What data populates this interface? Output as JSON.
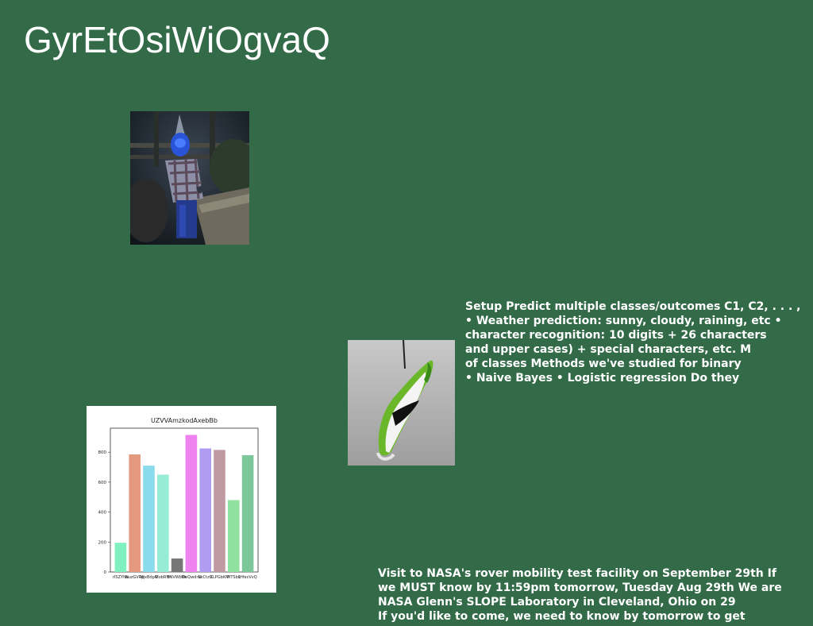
{
  "page": {
    "title": "GyrEtOsiWiOgvaQ",
    "background": "#336b48"
  },
  "text_block_1": {
    "lines": [
      "Setup Predict multiple classes/outcomes C1, C2, . . . ,",
      "• Weather prediction: sunny, cloudy, raining, etc •",
      "character recognition: 10 digits + 26 characters",
      "and upper cases) + special characters, etc. M",
      "of classes Methods we've studied for binary",
      "• Naive Bayes • Logistic regression Do they"
    ]
  },
  "text_block_2": {
    "lines": [
      "Visit to NASA's rover mobility test facility on September 29th If",
      "we MUST know by 11:59pm tomorrow, Tuesday Aug 29th We are",
      "NASA Glenn's SLOPE Laboratory in Cleveland, Ohio on 29",
      "If you'd like to come, we need to know by tomorrow to get"
    ]
  },
  "chart_data": {
    "type": "bar",
    "title": "UZVVAmzkodAxebBb",
    "categories": [
      "rISZYNa",
      "NuzGVRp",
      "MjxBdpG",
      "MobRNr",
      "FNVWbDc",
      "WeQwdrN",
      "LkCtzG",
      "XLPGbKM",
      "MTSbL",
      "IHfecVvQ"
    ],
    "values": [
      195,
      785,
      710,
      650,
      90,
      915,
      825,
      815,
      480,
      780
    ],
    "colors": [
      "#7ff0c0",
      "#e59a80",
      "#8adcec",
      "#96ecd6",
      "#777777",
      "#ee82ee",
      "#b09cf0",
      "#c09aa2",
      "#90e0a0",
      "#7cc89a"
    ],
    "ylim": [
      0,
      960
    ],
    "yticks": [
      0,
      200,
      400,
      600,
      800
    ],
    "xlabel": "",
    "ylabel": ""
  }
}
